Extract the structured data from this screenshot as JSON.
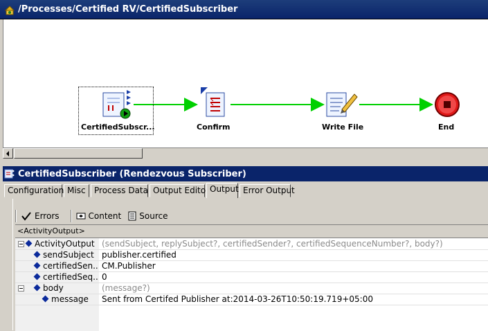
{
  "window": {
    "title": "/Processes/Certified RV/CertifiedSubscriber"
  },
  "nodes": [
    {
      "label": "CertifiedSubscr..."
    },
    {
      "label": "Confirm"
    },
    {
      "label": "Write File"
    },
    {
      "label": "End"
    }
  ],
  "panel": {
    "title": "CertifiedSubscriber (Rendezvous Subscriber)"
  },
  "tabs": [
    "Configuration",
    "Misc",
    "Process Data",
    "Output Editor",
    "Output",
    "Error Output"
  ],
  "active_tab": "Output",
  "toolbar": {
    "errors": "Errors",
    "content": "Content",
    "source": "Source"
  },
  "path": "<ActivityOutput>",
  "tree": [
    {
      "name": "ActivityOutput",
      "value": "(sendSubject, replySubject?, certifiedSender?, certifiedSequenceNumber?, body?)"
    },
    {
      "name": "sendSubject",
      "value": "publisher.certified"
    },
    {
      "name": "certifiedSen...",
      "value": "CM.Publisher"
    },
    {
      "name": "certifiedSeq...",
      "value": "0"
    },
    {
      "name": "body",
      "value": "(message?)"
    },
    {
      "name": "message",
      "value": "Sent from Certifed Publisher at:2014-03-26T10:50:19.719+05:00"
    }
  ],
  "colors": {
    "title_bg": "#0a246a",
    "arrow": "#00d000",
    "end": "#e01818"
  }
}
